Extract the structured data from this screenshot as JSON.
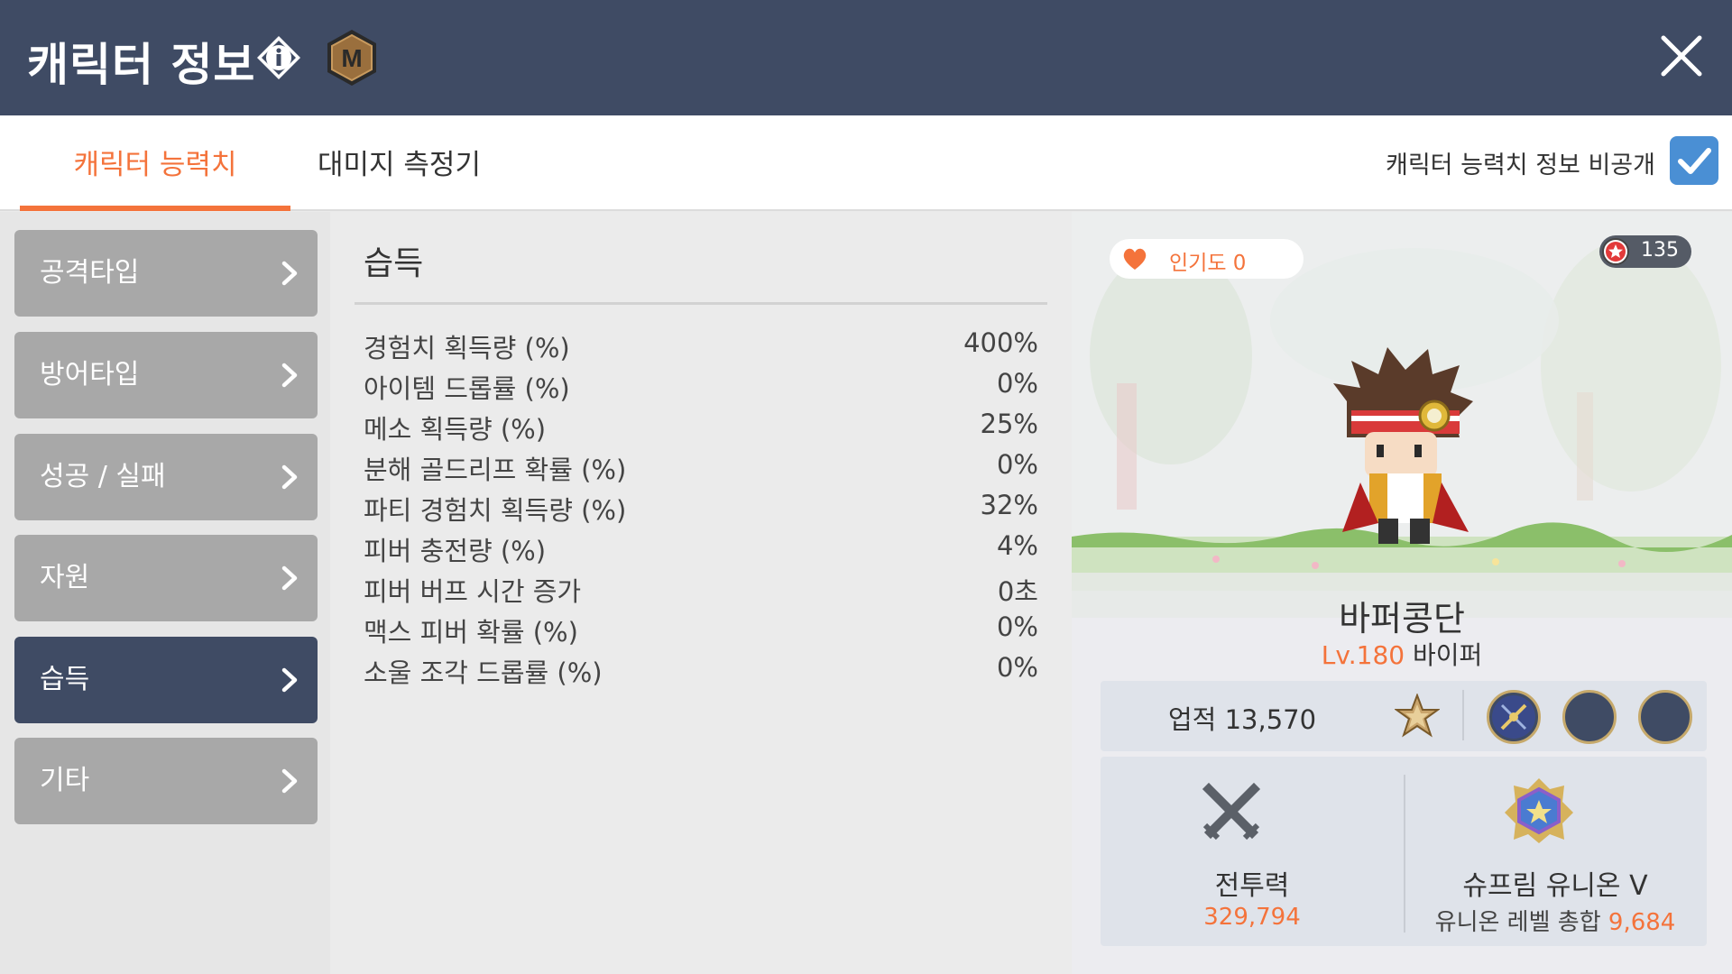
{
  "header": {
    "title": "캐릭터 정보",
    "info_icon": "info-icon",
    "m_icon": "m-badge-icon",
    "close_icon": "close-icon"
  },
  "tabs": [
    {
      "label": "캐릭터 능력치",
      "active": true
    },
    {
      "label": "대미지 측정기",
      "active": false
    }
  ],
  "privacy": {
    "label": "캐릭터 능력치 정보 비공개",
    "checked": true
  },
  "sidebar": {
    "items": [
      {
        "label": "공격타입",
        "active": false
      },
      {
        "label": "방어타입",
        "active": false
      },
      {
        "label": "성공 / 실패",
        "active": false
      },
      {
        "label": "자원",
        "active": false
      },
      {
        "label": "습득",
        "active": true
      },
      {
        "label": "기타",
        "active": false
      }
    ]
  },
  "section": {
    "title": "습득",
    "rows": [
      {
        "name": "경험치 획득량 (%)",
        "value": "400%"
      },
      {
        "name": "아이템 드롭률 (%)",
        "value": "0%"
      },
      {
        "name": "메소 획득량 (%)",
        "value": "25%"
      },
      {
        "name": "분해 골드리프 확률 (%)",
        "value": "0%"
      },
      {
        "name": "파티 경험치 획득량 (%)",
        "value": "32%"
      },
      {
        "name": "피버 충전량 (%)",
        "value": "4%"
      },
      {
        "name": "피버 버프 시간 증가",
        "value": "0초"
      },
      {
        "name": "맥스 피버 확률 (%)",
        "value": "0%"
      },
      {
        "name": "소울 조각 드롭률 (%)",
        "value": "0%"
      }
    ]
  },
  "profile": {
    "popularity": "인기도 0",
    "star_count": "135",
    "name": "바퍼콩단",
    "level": "Lv.180",
    "job": "바이퍼",
    "achievement": "업적 13,570",
    "power_label": "전투력",
    "power_value": "329,794",
    "union_label": "슈프림 유니온 V",
    "union_level_label": "유니온 레벨 총합",
    "union_level_value": "9,684"
  },
  "colors": {
    "header_bg": "#3f4b64",
    "accent": "#f4733b",
    "checkbox": "#4a8fd4",
    "sidebar_item": "#a8a8a8",
    "sidebar_active": "#3f4b64"
  }
}
